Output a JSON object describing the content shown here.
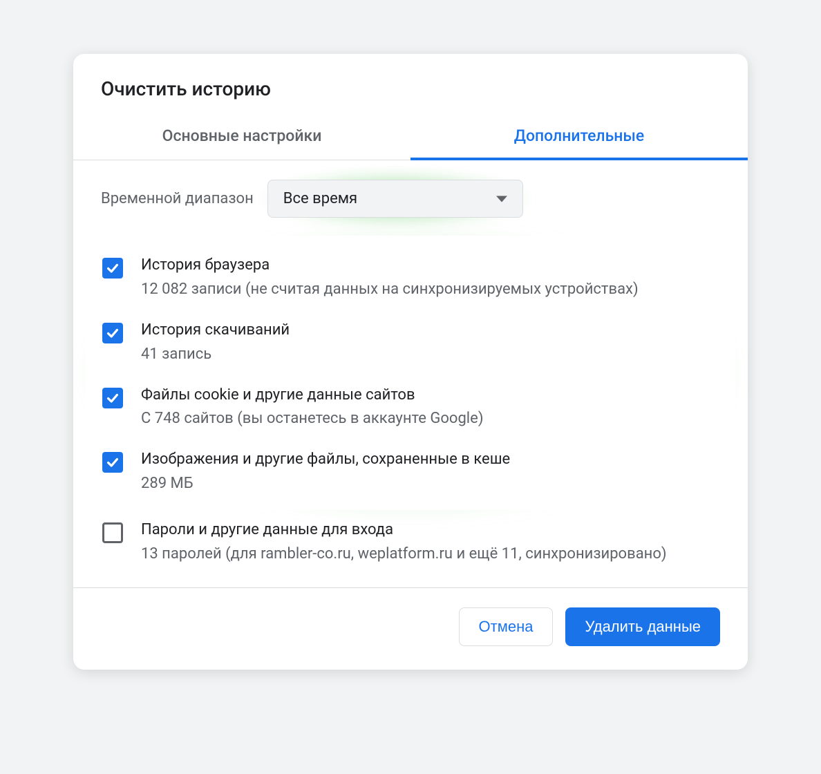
{
  "dialog": {
    "title": "Очистить историю",
    "tabs": {
      "basic": "Основные настройки",
      "advanced": "Дополнительные"
    },
    "timerange": {
      "label": "Временной диапазон",
      "selected": "Все время"
    },
    "options": [
      {
        "title": "История браузера",
        "subtitle": "12 082 записи (не считая данных на синхронизируемых устройствах)",
        "checked": true,
        "highlighted": true
      },
      {
        "title": "История скачиваний",
        "subtitle": "41 запись",
        "checked": true,
        "highlighted": true
      },
      {
        "title": "Файлы cookie и другие данные сайтов",
        "subtitle": "С 748 сайтов (вы останетесь в аккаунте Google)",
        "checked": true,
        "highlighted": true
      },
      {
        "title": "Изображения и другие файлы, сохраненные в кеше",
        "subtitle": "289 МБ",
        "checked": true,
        "highlighted": true
      },
      {
        "title": "Пароли и другие данные для входа",
        "subtitle": "13 паролей (для rambler-co.ru, weplatform.ru и ещё 11, синхронизировано)",
        "checked": false,
        "highlighted": false
      }
    ],
    "footer": {
      "cancel": "Отмена",
      "confirm": "Удалить данные"
    }
  }
}
